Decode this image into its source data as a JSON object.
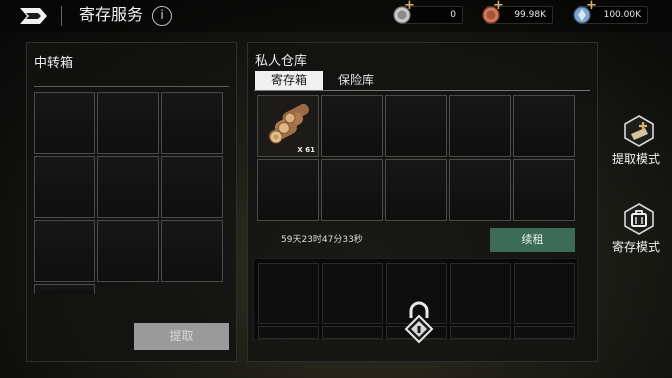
{
  "header": {
    "title": "寄存服务",
    "info_icon": "i",
    "currencies": [
      {
        "icon": "silver-coin-icon",
        "value": "0"
      },
      {
        "icon": "copper-coin-icon",
        "value": "99.98K"
      },
      {
        "icon": "crystal-coin-icon",
        "value": "100.00K"
      }
    ]
  },
  "transfer_box": {
    "title": "中转箱",
    "take_button": "提取"
  },
  "warehouse": {
    "title": "私人仓库",
    "tabs": [
      {
        "label": "寄存箱",
        "active": true
      },
      {
        "label": "保险库",
        "active": false
      }
    ],
    "items": [
      {
        "name": "wood-logs",
        "quantity": "X 61"
      }
    ],
    "timer": "59天23时47分33秒",
    "renew_button": "续租"
  },
  "modes": {
    "extract": "提取模式",
    "deposit": "寄存模式"
  },
  "colors": {
    "renew_button": "#3d6b59",
    "take_button_disabled": "#9a9a9a",
    "plus_accent": "#d9b36a"
  }
}
